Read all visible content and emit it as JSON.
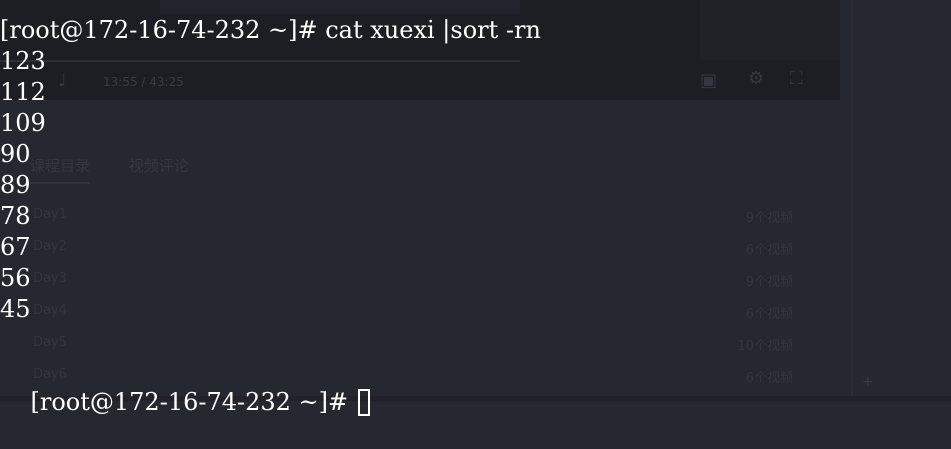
{
  "background_page": {
    "player": {
      "time": "13:55 / 43:25",
      "icons": [
        "volume-icon",
        "fullscreen-icon",
        "settings-icon",
        "pip-icon"
      ]
    },
    "tabs": [
      {
        "label": "课程目录",
        "active": true
      },
      {
        "label": "视频评论",
        "active": false
      }
    ],
    "lessons": [
      {
        "title": "Day1",
        "meta": "9个视频"
      },
      {
        "title": "Day2",
        "meta": "6个视频"
      },
      {
        "title": "Day3",
        "meta": "9个视频"
      },
      {
        "title": "Day4",
        "meta": "6个视频"
      },
      {
        "title": "Day5",
        "meta": "10个视频"
      },
      {
        "title": "Day6",
        "meta": "6个视频"
      }
    ]
  },
  "terminal": {
    "command_line": "[root@172-16-74-232 ~]# cat xuexi |sort -rn",
    "output": [
      "123",
      "112",
      "109",
      "90",
      "89",
      "78",
      "67",
      "56",
      "45"
    ],
    "prompt": "[root@172-16-74-232 ~]# "
  }
}
